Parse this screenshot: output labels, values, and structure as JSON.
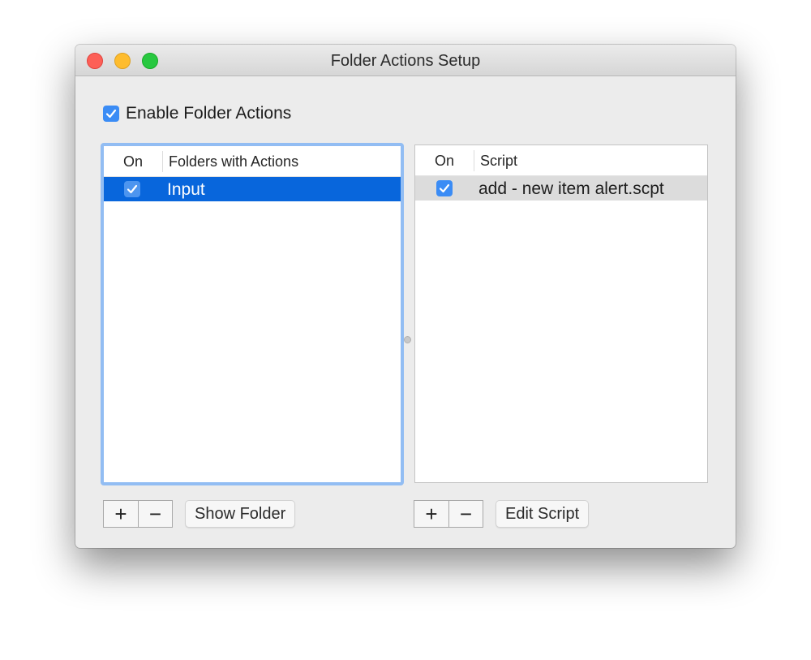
{
  "window": {
    "title": "Folder Actions Setup"
  },
  "enable": {
    "label": "Enable Folder Actions",
    "checked": true
  },
  "folders_table": {
    "columns": [
      "On",
      "Folders with Actions"
    ],
    "rows": [
      {
        "on": true,
        "name": "Input",
        "selected": true
      }
    ]
  },
  "scripts_table": {
    "columns": [
      "On",
      "Script"
    ],
    "rows": [
      {
        "on": true,
        "name": "add - new item alert.scpt",
        "selected": true
      }
    ]
  },
  "folder_controls": {
    "add_label": "+",
    "remove_label": "−",
    "show_folder_label": "Show Folder"
  },
  "script_controls": {
    "add_label": "+",
    "remove_label": "−",
    "edit_script_label": "Edit Script"
  },
  "colors": {
    "selection": "#0866dc",
    "checkbox": "#3b8cf5",
    "focus_ring": "#92bdf3"
  }
}
